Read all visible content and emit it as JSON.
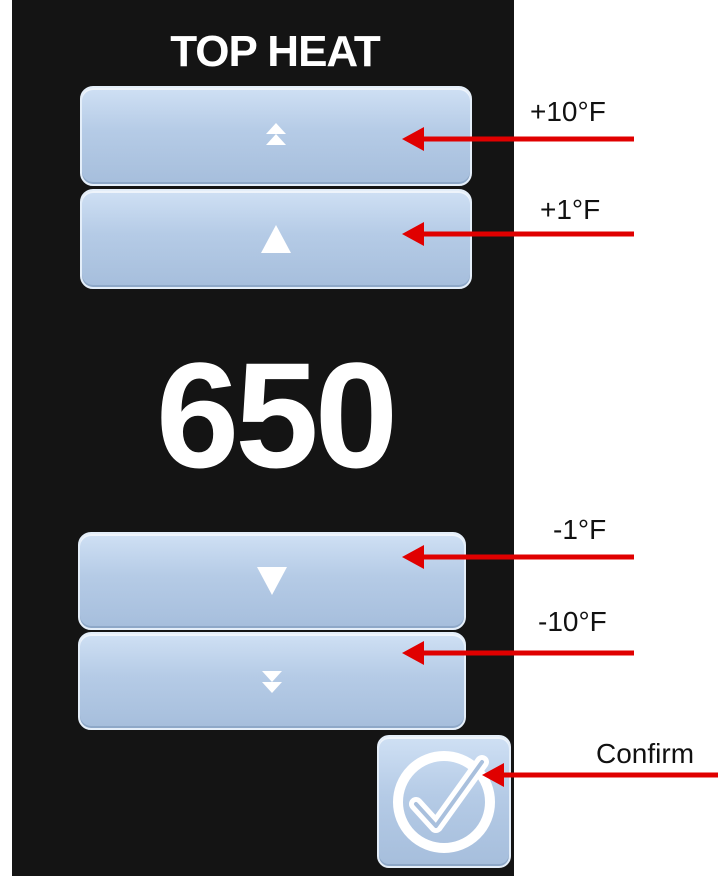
{
  "panel": {
    "title": "TOP HEAT",
    "temperature": "650"
  },
  "buttons": {
    "up10": {
      "icon": "double-up-arrow-icon"
    },
    "up1": {
      "icon": "up-arrow-icon"
    },
    "down1": {
      "icon": "down-arrow-icon"
    },
    "down10": {
      "icon": "double-down-arrow-icon"
    },
    "confirm": {
      "icon": "checkmark-icon"
    }
  },
  "annotations": {
    "up10": "+10°F",
    "up1": "+1°F",
    "down1": "-1°F",
    "down10": "-10°F",
    "confirm": "Confirm"
  },
  "colors": {
    "screen_bg": "#141414",
    "button_fill": "#b5cbe6",
    "arrow_red": "#e00000",
    "text_white": "#ffffff"
  }
}
